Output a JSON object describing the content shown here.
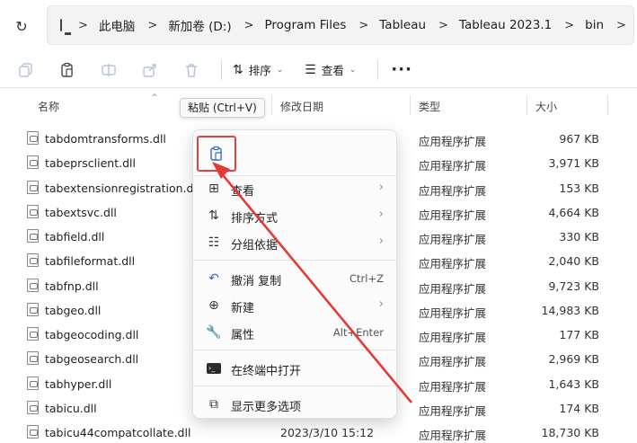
{
  "address": {
    "breadcrumbs": [
      "此电脑",
      "新加卷 (D:)",
      "Program Files",
      "Tableau",
      "Tableau 2023.1",
      "bin"
    ],
    "separator": ">"
  },
  "toolbar": {
    "sort_label": "排序",
    "view_label": "查看",
    "more_label": "···"
  },
  "columns": {
    "name": "名称",
    "modified": "修改日期",
    "type": "类型",
    "size": "大小"
  },
  "tooltip": "粘贴 (Ctrl+V)",
  "files": [
    {
      "name": "tabdomtransforms.dll",
      "date": "",
      "type": "应用程序扩展",
      "size": "967 KB"
    },
    {
      "name": "tabeprsclient.dll",
      "date": "",
      "type": "应用程序扩展",
      "size": "3,971 KB"
    },
    {
      "name": "tabextensionregistration.dll",
      "date": "",
      "type": "应用程序扩展",
      "size": "153 KB"
    },
    {
      "name": "tabextsvc.dll",
      "date": "",
      "type": "应用程序扩展",
      "size": "4,664 KB"
    },
    {
      "name": "tabfield.dll",
      "date": "",
      "type": "应用程序扩展",
      "size": "330 KB"
    },
    {
      "name": "tabfileformat.dll",
      "date": "",
      "type": "应用程序扩展",
      "size": "2,040 KB"
    },
    {
      "name": "tabfnp.dll",
      "date": "",
      "type": "应用程序扩展",
      "size": "9,723 KB"
    },
    {
      "name": "tabgeo.dll",
      "date": "",
      "type": "应用程序扩展",
      "size": "14,983 KB"
    },
    {
      "name": "tabgeocoding.dll",
      "date": "",
      "type": "应用程序扩展",
      "size": "177 KB"
    },
    {
      "name": "tabgeosearch.dll",
      "date": "",
      "type": "应用程序扩展",
      "size": "2,969 KB"
    },
    {
      "name": "tabhyper.dll",
      "date": "",
      "type": "应用程序扩展",
      "size": "1,643 KB"
    },
    {
      "name": "tabicu.dll",
      "date": "",
      "type": "应用程序扩展",
      "size": "174 KB"
    },
    {
      "name": "tabicu44compatcollate.dll",
      "date": "2023/3/10 15:12",
      "type": "应用程序扩展",
      "size": "18,730 KB"
    }
  ],
  "context_menu": {
    "items": [
      {
        "label": "查看",
        "shortcut": "",
        "submenu": true
      },
      {
        "label": "排序方式",
        "shortcut": "",
        "submenu": true
      },
      {
        "label": "分组依据",
        "shortcut": "",
        "submenu": true
      },
      {
        "label": "撤消 复制",
        "shortcut": "Ctrl+Z",
        "submenu": false
      },
      {
        "label": "新建",
        "shortcut": "",
        "submenu": true
      },
      {
        "label": "属性",
        "shortcut": "Alt+Enter",
        "submenu": false
      },
      {
        "label": "在终端中打开",
        "shortcut": "",
        "submenu": false
      },
      {
        "label": "显示更多选项",
        "shortcut": "",
        "submenu": false
      }
    ]
  },
  "colors": {
    "highlight": "#e04040",
    "arrow": "#e53935"
  }
}
